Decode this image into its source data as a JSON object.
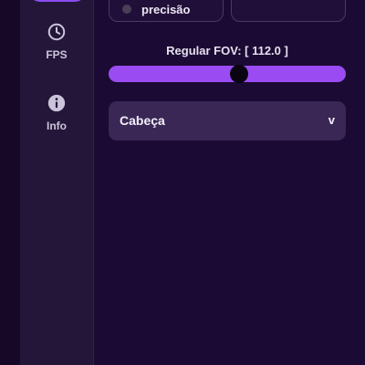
{
  "sidebar": {
    "items": [
      {
        "label": "FPS",
        "icon": "clock-icon"
      },
      {
        "label": "Info",
        "icon": "info-icon"
      }
    ]
  },
  "precision_card": {
    "label": "precisão"
  },
  "fov": {
    "title": "Regular FOV: [ 112.0 ]",
    "value": 112.0,
    "fill_fraction": 0.55
  },
  "target_select": {
    "selected": "Cabeça",
    "chevron": "v"
  },
  "colors": {
    "background": "#1b0a33",
    "sidebar": "#231638",
    "accent": "#9a4cf2",
    "active_tab": "#8a4df0",
    "dropdown": "#3a2755"
  }
}
